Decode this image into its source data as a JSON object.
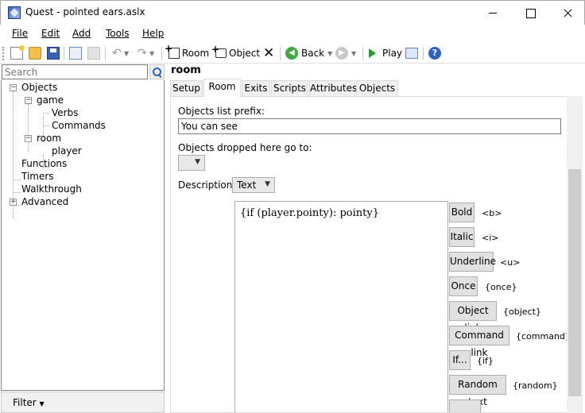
{
  "window": {
    "title": "Quest - pointed ears.aslx"
  },
  "menu": [
    "File",
    "Edit",
    "Add",
    "Tools",
    "Help"
  ],
  "toolbar": {
    "room_label": "Room",
    "object_label": "Object",
    "back_label": "Back",
    "play_label": "Play"
  },
  "search": {
    "placeholder": "Search"
  },
  "tree": {
    "objects": "Objects",
    "game": "game",
    "verbs": "Verbs",
    "commands": "Commands",
    "room": "room",
    "player": "player",
    "functions": "Functions",
    "timers": "Timers",
    "walkthrough": "Walkthrough",
    "advanced": "Advanced"
  },
  "filter": {
    "label": "Filter"
  },
  "editor": {
    "object_name": "room",
    "tabs": [
      "Setup",
      "Room",
      "Exits",
      "Scripts",
      "Attributes",
      "Objects"
    ],
    "active_tab": "Room",
    "objects_list_prefix_label": "Objects list prefix:",
    "objects_list_prefix_value": "You can see",
    "dropped_label": "Objects dropped here go to:",
    "dropped_value": "",
    "description_label": "Description:",
    "description_type": "Text",
    "description_text": "{if (player.pointy): pointy}",
    "format_buttons": [
      {
        "label": "Bold",
        "tag": "<b>"
      },
      {
        "label": "Italic",
        "tag": "<i>"
      },
      {
        "label": "Underline",
        "tag": "<u>"
      },
      {
        "label": "Once",
        "tag": "{once}"
      },
      {
        "label": "Object link",
        "tag": "{object}"
      },
      {
        "label": "Command link",
        "tag": "{command}"
      },
      {
        "label": "If...",
        "tag": "{if}"
      },
      {
        "label": "Random text",
        "tag": "{random}"
      }
    ]
  }
}
